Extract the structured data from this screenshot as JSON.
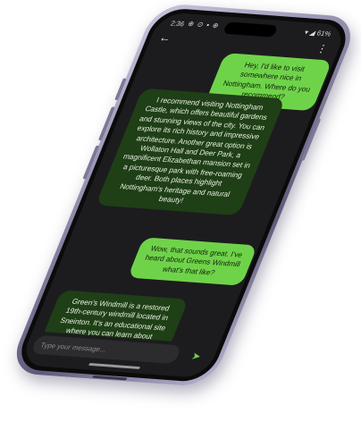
{
  "status_bar": {
    "time": "2:36",
    "left_icons": "⊕ ⊙ ▪ ⊕",
    "right_text": "▾ ◢ 61%"
  },
  "header": {
    "back_icon": "←",
    "menu_icon": "⋮"
  },
  "messages": [
    {
      "role": "user",
      "text": "Hey, I'd like to visit somewhere nice in Nottingham. Where do you recommend?"
    },
    {
      "role": "assistant",
      "text": "I recommend visiting Nottingham Castle, which offers beautiful gardens and stunning views of the city. You can explore its rich history and impressive architecture. Another great option is Wollaton Hall and Deer Park, a magnificent Elizabethan mansion set in a picturesque park with free-roaming deer. Both places highlight Nottingham's heritage and natural beauty!"
    },
    {
      "role": "user",
      "text": "Wow, that sounds great. I've heard about Greens Windmill what's that like?"
    },
    {
      "role": "assistant",
      "text": "Green's Windmill is a restored 19th-century windmill located in Sneinton. It's an educational site where you can learn about"
    }
  ],
  "composer": {
    "placeholder": "Type your message...",
    "send_icon": "➤"
  },
  "colors": {
    "user_bubble": "#6fd34a",
    "assistant_bubble": "#1f3f17",
    "screen_background": "#1c1c1e",
    "phone_frame": "#8a86a6"
  }
}
